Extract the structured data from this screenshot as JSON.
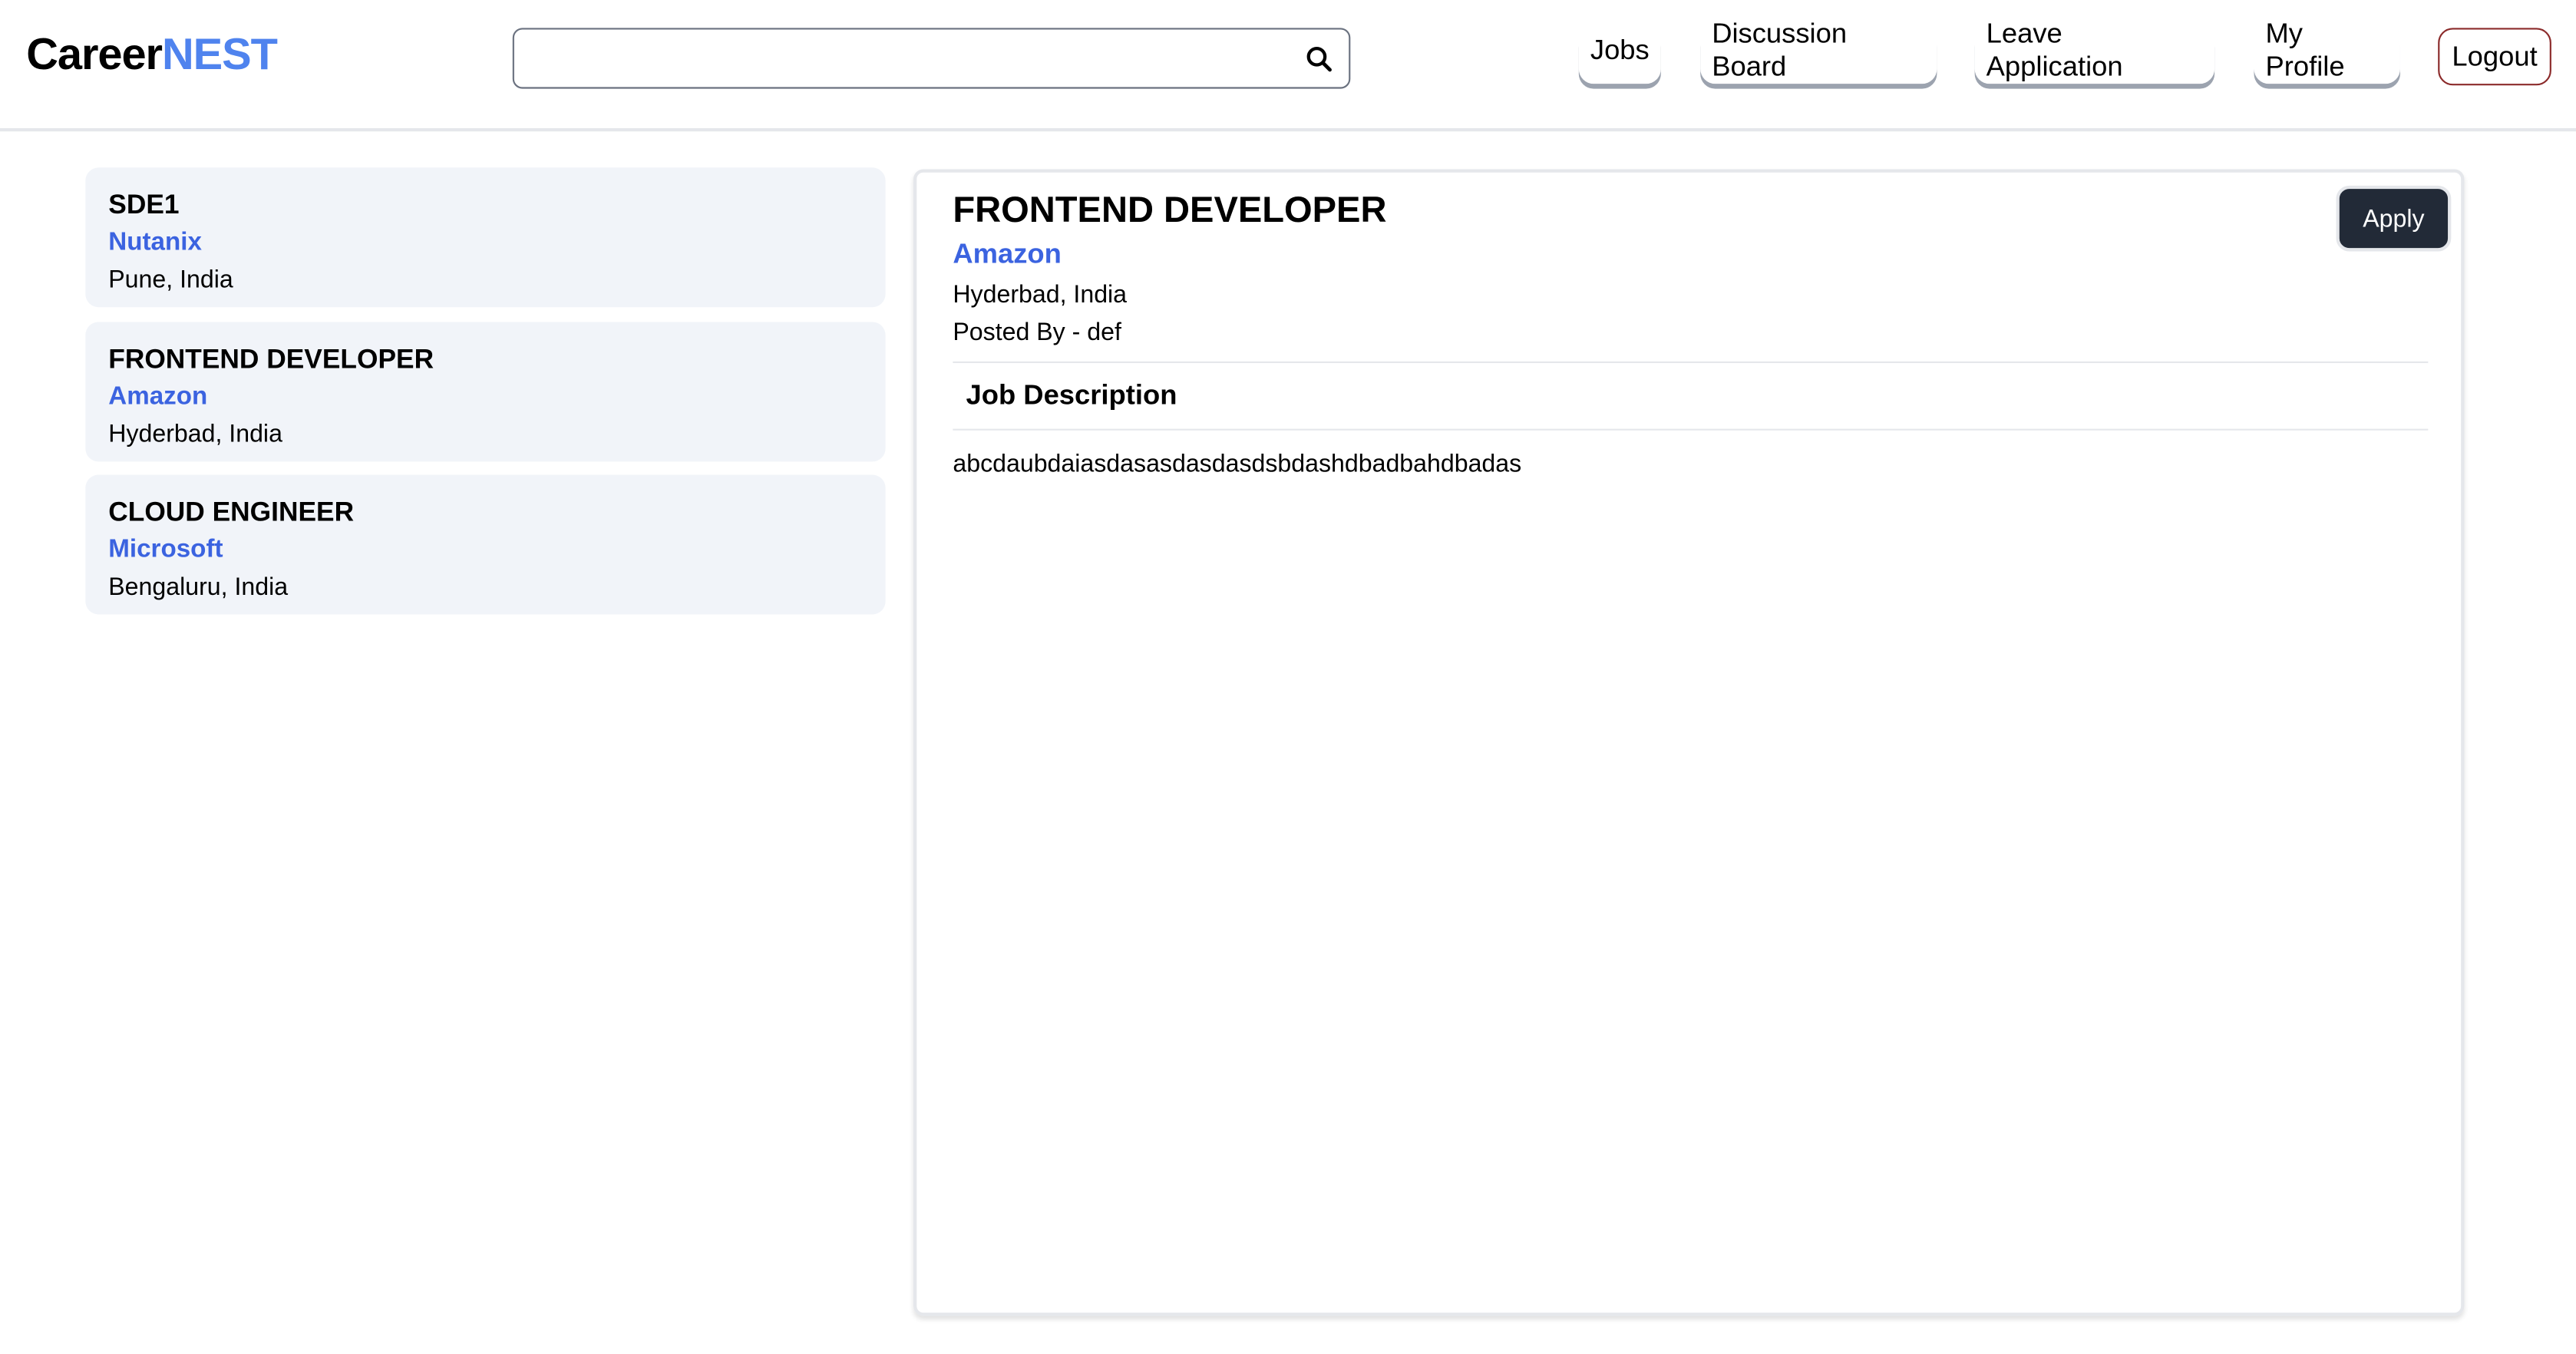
{
  "header": {
    "logo_part1": "Career",
    "logo_part2": "NEST",
    "search": {
      "value": "",
      "placeholder": ""
    },
    "nav": [
      "Jobs",
      "Discussion Board",
      "Leave Application",
      "My Profile"
    ],
    "logout_label": "Logout"
  },
  "job_list": [
    {
      "title": "SDE1",
      "company": "Nutanix",
      "location": "Pune, India"
    },
    {
      "title": "FRONTEND DEVELOPER",
      "company": "Amazon",
      "location": "Hyderbad, India"
    },
    {
      "title": "CLOUD ENGINEER",
      "company": "Microsoft",
      "location": "Bengaluru, India"
    }
  ],
  "detail": {
    "title": "FRONTEND DEVELOPER",
    "company": "Amazon",
    "location": "Hyderbad, India",
    "posted_by": "Posted By - def",
    "apply_label": "Apply",
    "description_heading": "Job Description",
    "description": "abcdaubdaiasdasasdasdasdsbdashdbadbahdbadas"
  },
  "colors": {
    "brand": "#4f83ee",
    "company": "#3b63e0",
    "apply_bg": "#222a37",
    "card_bg": "#f1f4f9",
    "logout_border": "#8b2a2a"
  }
}
